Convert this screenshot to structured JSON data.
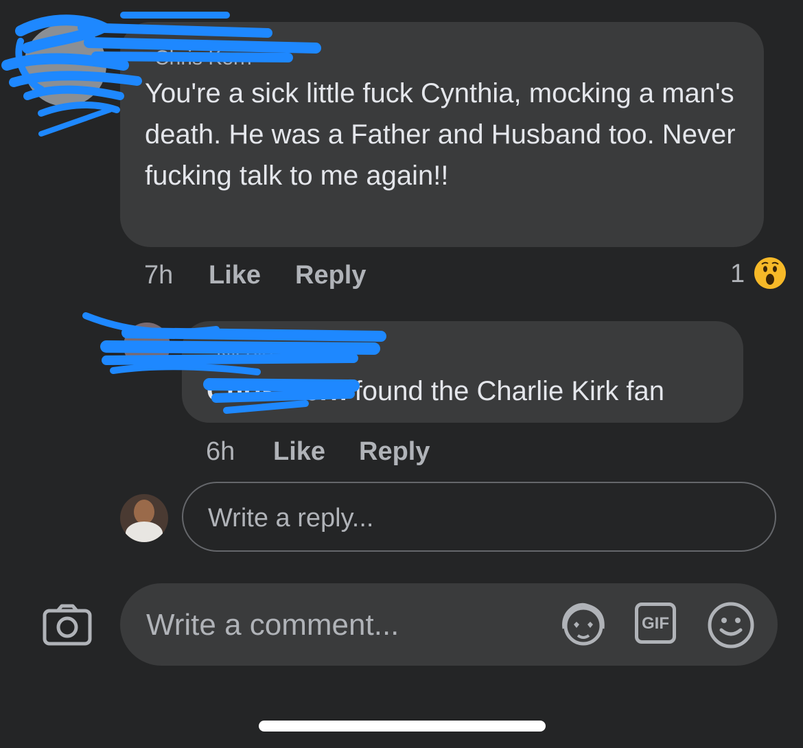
{
  "comment": {
    "author": "Chris Kern",
    "text": "You're a sick little fuck Cynthia, mocking a man's death. He was a Father and Husband too. Never fucking talk to me again!!",
    "time": "7h",
    "like_label": "Like",
    "reply_label": "Reply",
    "reaction_count": "1",
    "reaction_icon": "wow-emoji-icon"
  },
  "reply": {
    "author": "Nicole Cozma",
    "mention": "Chris Kern",
    "text": " found the Charlie Kirk fan",
    "time": "6h",
    "like_label": "Like",
    "reply_label": "Reply"
  },
  "reply_box": {
    "placeholder": "Write a reply..."
  },
  "comment_bar": {
    "placeholder": "Write a comment...",
    "icons": [
      "camera-icon",
      "avatar-sticker-icon",
      "gif-icon",
      "emoji-icon"
    ],
    "gif_label": "GIF"
  },
  "colors": {
    "background": "#242526",
    "bubble": "#3a3b3c",
    "redaction": "#1e88ff",
    "secondary_text": "#b0b3b8"
  }
}
